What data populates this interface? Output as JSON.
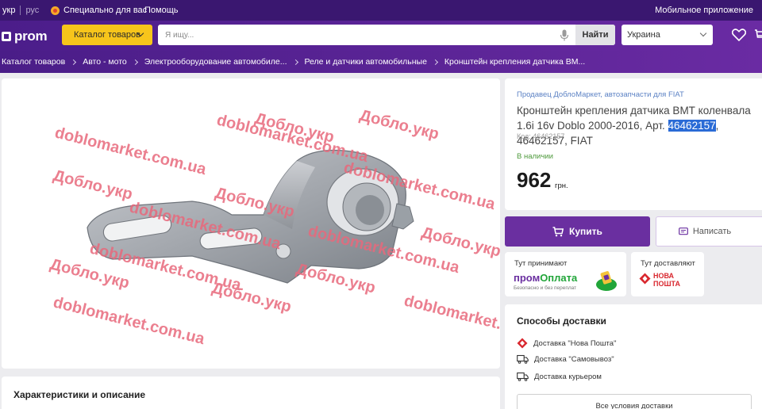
{
  "topbar": {
    "lang_active": "укр",
    "lang_inactive": "рус",
    "promo": "Специально для вас",
    "help": "Помощь",
    "mobile_app": "Мобильное приложение"
  },
  "header": {
    "logo": "prom",
    "catalog_button": "Каталог товаров",
    "search_placeholder": "Я ищу...",
    "search_button": "Найти",
    "region": "Украина"
  },
  "breadcrumbs": [
    "Каталог товаров",
    "Авто - мото",
    "Электрооборудование автомобиле...",
    "Реле и датчики автомобильные",
    "Кронштейн крепления датчика ВМ..."
  ],
  "gallery": {
    "watermark_domain": "doblomarket.com.ua",
    "watermark_cyr": "Добло.укр"
  },
  "product": {
    "seller": "Продавец ДоблоМаркет, автозапчасти для FIAT",
    "title_before": "Кронштейн крепления датчика ВМТ коленвала 1.6i 16v Doblo 2000-2016, Арт. ",
    "title_highlight": "46462157",
    "title_after": ", 46462157, FIAT",
    "code": "Код: 46462157",
    "stock": "В наличии",
    "price": "962",
    "currency": "грн."
  },
  "actions": {
    "buy": "Купить",
    "message": "Написать"
  },
  "payment": {
    "label": "Тут принимают",
    "brand_part1": "пром",
    "brand_part2": "Оплата",
    "subtitle": "Безопасно и без переплат"
  },
  "delivery_badge": {
    "label": "Тут доставляют",
    "brand_line1": "НОВА",
    "brand_line2": "ПОШТА"
  },
  "shipping": {
    "title": "Способы доставки",
    "methods": [
      "Доставка \"Нова Пошта\"",
      "Доставка \"Самовывоз\"",
      "Доставка курьером"
    ],
    "all_button": "Все условия доставки"
  },
  "characteristics": {
    "title": "Характеристики и описание"
  },
  "colors": {
    "topbar": "#3a1770",
    "header": "#5d2599",
    "catalog_button": "#f7c51b",
    "buy_button": "#6a2fa0",
    "price_link": "#5c82c4",
    "in_stock": "#4e9a3c",
    "watermark": "#e8697c",
    "nova_poshta": "#d9282f"
  }
}
